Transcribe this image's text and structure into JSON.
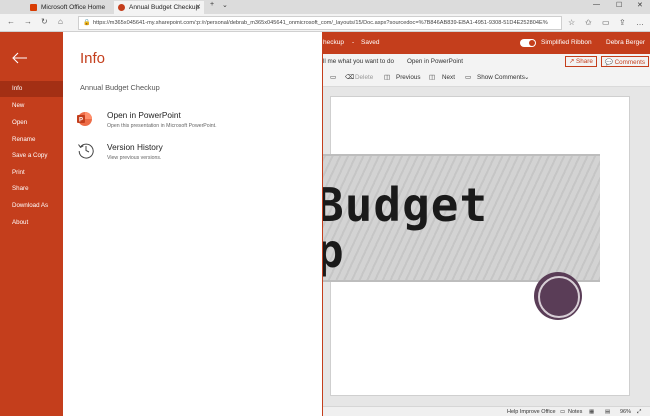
{
  "browser": {
    "tabs": [
      {
        "label": "Microsoft Office Home",
        "active": false
      },
      {
        "label": "Annual Budget Checkup",
        "active": true
      }
    ],
    "url": "https://m365x045641-my.sharepoint.com/:p:/r/personal/debrab_m365x045641_onmicrosoft_com/_layouts/15/Doc.aspx?sourcedoc=%7B846AB839-EBA1-4951-9308-51D4E252804E%"
  },
  "app": {
    "doc_title": "heckup",
    "save_status": "Saved",
    "simplified_ribbon_label": "Simplified Ribbon",
    "user_name": "Debra Berger",
    "tell_me": "ll me what you want to do",
    "open_in_app": "Open in PowerPoint",
    "share_label": "Share",
    "comments_label": "Comments",
    "review_toolbar": {
      "delete": "Delete",
      "previous": "Previous",
      "next": "Next",
      "show_comments": "Show Comments"
    },
    "slide": {
      "line1": "Budget",
      "line2": "p"
    },
    "status": {
      "help_improve": "Help Improve Office",
      "notes": "Notes",
      "zoom": "96%"
    }
  },
  "backstage": {
    "nav": [
      {
        "label": "Info",
        "selected": true
      },
      {
        "label": "New",
        "selected": false
      },
      {
        "label": "Open",
        "selected": false
      },
      {
        "label": "Rename",
        "selected": false
      },
      {
        "label": "Save a Copy",
        "selected": false
      },
      {
        "label": "Print",
        "selected": false
      },
      {
        "label": "Share",
        "selected": false
      },
      {
        "label": "Download As",
        "selected": false
      },
      {
        "label": "About",
        "selected": false
      }
    ],
    "title": "Info",
    "file_name": "Annual Budget Checkup",
    "options": [
      {
        "title": "Open in PowerPoint",
        "description": "Open this presentation in Microsoft PowerPoint.",
        "icon": "powerpoint-icon"
      },
      {
        "title": "Version History",
        "description": "View previous versions.",
        "icon": "history-icon"
      }
    ]
  },
  "colors": {
    "brand": "#c43e1c",
    "brand_dark": "#a32f14"
  }
}
